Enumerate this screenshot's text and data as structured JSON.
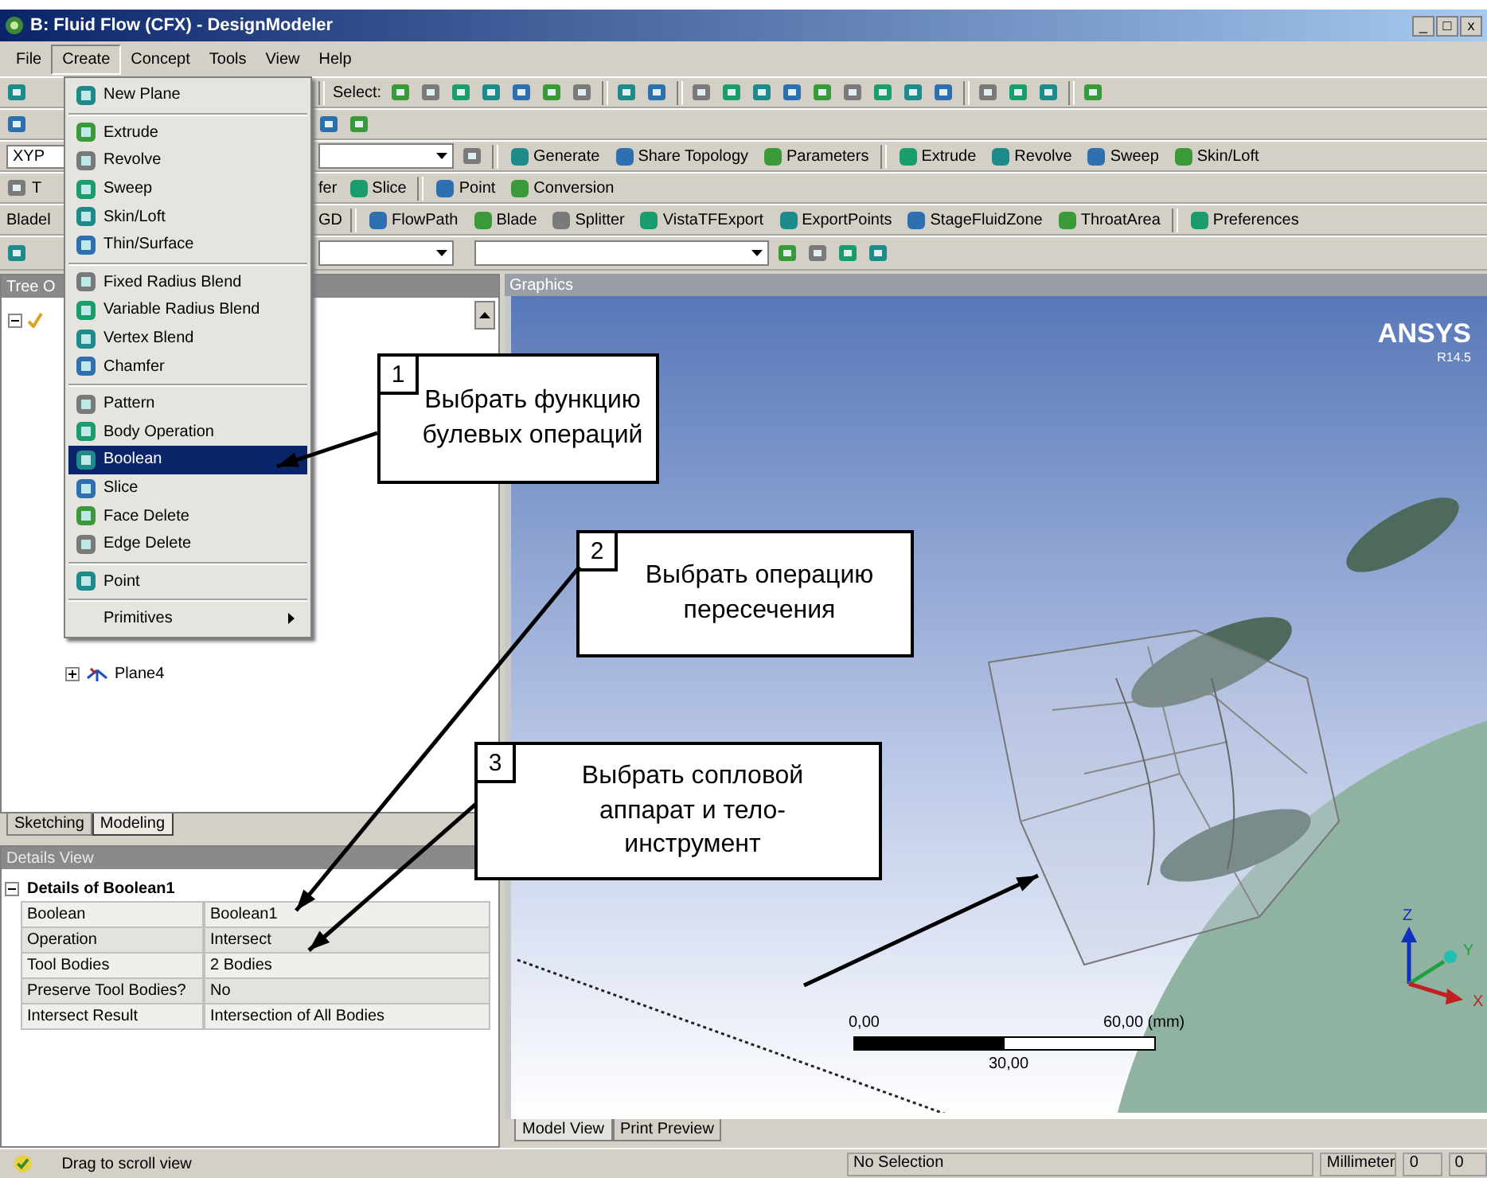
{
  "window": {
    "title": "B: Fluid Flow (CFX) - DesignModeler",
    "controls": [
      "_",
      "□",
      "x"
    ]
  },
  "menu_bar": [
    {
      "label": "File",
      "selected": false
    },
    {
      "label": "Create",
      "selected": true
    },
    {
      "label": "Concept",
      "selected": false
    },
    {
      "label": "Tools",
      "selected": false
    },
    {
      "label": "View",
      "selected": false
    },
    {
      "label": "Help",
      "selected": false
    }
  ],
  "create_menu": [
    {
      "kind": "item",
      "label": "New Plane",
      "selected": false
    },
    {
      "kind": "separator"
    },
    {
      "kind": "item",
      "label": "Extrude",
      "selected": false
    },
    {
      "kind": "item",
      "label": "Revolve",
      "selected": false
    },
    {
      "kind": "item",
      "label": "Sweep",
      "selected": false
    },
    {
      "kind": "item",
      "label": "Skin/Loft",
      "selected": false
    },
    {
      "kind": "item",
      "label": "Thin/Surface",
      "selected": false
    },
    {
      "kind": "separator"
    },
    {
      "kind": "item",
      "label": "Fixed Radius Blend",
      "selected": false
    },
    {
      "kind": "item",
      "label": "Variable Radius Blend",
      "selected": false
    },
    {
      "kind": "item",
      "label": "Vertex Blend",
      "selected": false
    },
    {
      "kind": "item",
      "label": "Chamfer",
      "selected": false
    },
    {
      "kind": "separator"
    },
    {
      "kind": "item",
      "label": "Pattern",
      "selected": false
    },
    {
      "kind": "item",
      "label": "Body Operation",
      "selected": false
    },
    {
      "kind": "item",
      "label": "Boolean",
      "selected": true
    },
    {
      "kind": "item",
      "label": "Slice",
      "selected": false
    },
    {
      "kind": "item",
      "label": "Face Delete",
      "selected": false
    },
    {
      "kind": "item",
      "label": "Edge Delete",
      "selected": false
    },
    {
      "kind": "separator"
    },
    {
      "kind": "item",
      "label": "Point",
      "selected": false
    },
    {
      "kind": "separator"
    },
    {
      "kind": "submenu",
      "label": "Primitives",
      "selected": false
    }
  ],
  "toolbars": [
    {
      "left": [
        {
          "kind": "icon"
        }
      ],
      "right": [
        {
          "kind": "separator"
        },
        {
          "kind": "text",
          "label": "Select:"
        },
        {
          "kind": "icon"
        },
        {
          "kind": "icon"
        },
        {
          "kind": "icon"
        },
        {
          "kind": "icon"
        },
        {
          "kind": "icon"
        },
        {
          "kind": "icon"
        },
        {
          "kind": "icon"
        },
        {
          "kind": "separator"
        },
        {
          "kind": "icon"
        },
        {
          "kind": "icon"
        },
        {
          "kind": "separator"
        },
        {
          "kind": "icon"
        },
        {
          "kind": "icon"
        },
        {
          "kind": "icon"
        },
        {
          "kind": "icon"
        },
        {
          "kind": "icon"
        },
        {
          "kind": "icon"
        },
        {
          "kind": "icon"
        },
        {
          "kind": "icon"
        },
        {
          "kind": "icon"
        },
        {
          "kind": "separator"
        },
        {
          "kind": "icon"
        },
        {
          "kind": "icon"
        },
        {
          "kind": "icon"
        },
        {
          "kind": "separator"
        },
        {
          "kind": "icon"
        }
      ]
    },
    {
      "left": [
        {
          "kind": "icon"
        }
      ],
      "right": [
        {
          "kind": "icon"
        },
        {
          "kind": "icon"
        }
      ]
    },
    {
      "left": [
        {
          "kind": "field",
          "value": "XYP"
        }
      ],
      "right": [
        {
          "kind": "dropdown"
        },
        {
          "kind": "icon"
        },
        {
          "kind": "separator"
        },
        {
          "kind": "button",
          "label": "Generate"
        },
        {
          "kind": "button",
          "label": "Share Topology"
        },
        {
          "kind": "button",
          "label": "Parameters"
        },
        {
          "kind": "separator"
        },
        {
          "kind": "button",
          "label": "Extrude"
        },
        {
          "kind": "button",
          "label": "Revolve"
        },
        {
          "kind": "button",
          "label": "Sweep"
        },
        {
          "kind": "button",
          "label": "Skin/Loft"
        }
      ]
    },
    {
      "left": [
        {
          "kind": "icon"
        },
        {
          "kind": "text",
          "label": "T"
        }
      ],
      "right": [
        {
          "kind": "text",
          "label": "fer"
        },
        {
          "kind": "button",
          "label": "Slice"
        },
        {
          "kind": "separator"
        },
        {
          "kind": "button",
          "label": "Point"
        },
        {
          "kind": "button",
          "label": "Conversion"
        }
      ]
    },
    {
      "left": [
        {
          "kind": "text",
          "label": "Bladel"
        }
      ],
      "right": [
        {
          "kind": "text",
          "label": "GD"
        },
        {
          "kind": "separator"
        },
        {
          "kind": "button",
          "label": "FlowPath"
        },
        {
          "kind": "button",
          "label": "Blade"
        },
        {
          "kind": "button",
          "label": "Splitter"
        },
        {
          "kind": "button",
          "label": "VistaTFExport"
        },
        {
          "kind": "button",
          "label": "ExportPoints"
        },
        {
          "kind": "button",
          "label": "StageFluidZone"
        },
        {
          "kind": "button",
          "label": "ThroatArea"
        },
        {
          "kind": "separator"
        },
        {
          "kind": "button",
          "label": "Preferences"
        }
      ]
    },
    {
      "left": [
        {
          "kind": "icon"
        }
      ],
      "right": [
        {
          "kind": "dropdown"
        },
        {
          "kind": "dropdown"
        },
        {
          "kind": "icon"
        },
        {
          "kind": "icon"
        },
        {
          "kind": "icon"
        },
        {
          "kind": "icon"
        }
      ]
    }
  ],
  "tree": {
    "header": "Tree O",
    "items": [
      {
        "expanded": true,
        "children": [
          {
            "label": "Plane4",
            "expanded": false
          }
        ]
      }
    ]
  },
  "panel_tabs": [
    {
      "label": "Sketching",
      "selected": false
    },
    {
      "label": "Modeling",
      "selected": true
    }
  ],
  "details": {
    "header": "Details View",
    "title": "Details of Boolean1",
    "expanded": true,
    "rows": [
      {
        "label": "Boolean",
        "value": "Boolean1"
      },
      {
        "label": "Operation",
        "value": "Intersect"
      },
      {
        "label": "Tool Bodies",
        "value": "2 Bodies"
      },
      {
        "label": "Preserve Tool Bodies?",
        "value": "No"
      },
      {
        "label": "Intersect Result",
        "value": "Intersection of All Bodies"
      }
    ]
  },
  "graphics": {
    "header": "Graphics",
    "logo": "ANSYS",
    "version": "R14.5",
    "scale": {
      "min": "0,00",
      "max": "60,00 (mm)",
      "mid": "30,00"
    },
    "axes": [
      "Z",
      "Y",
      "X"
    ],
    "view_tabs": [
      {
        "label": "Model View",
        "selected": true
      },
      {
        "label": "Print Preview",
        "selected": false
      }
    ]
  },
  "status_bar": {
    "message": "Drag to scroll view",
    "selection": "No Selection",
    "units": "Millimeter",
    "values": [
      "0",
      "0"
    ]
  },
  "annotations": [
    {
      "number": "1",
      "text": "Выбрать функцию\nбулевых операций"
    },
    {
      "number": "2",
      "text": "Выбрать операцию\nпересечения"
    },
    {
      "number": "3",
      "text": "Выбрать сопловой\nаппарат и тело-\nинструмент"
    }
  ]
}
